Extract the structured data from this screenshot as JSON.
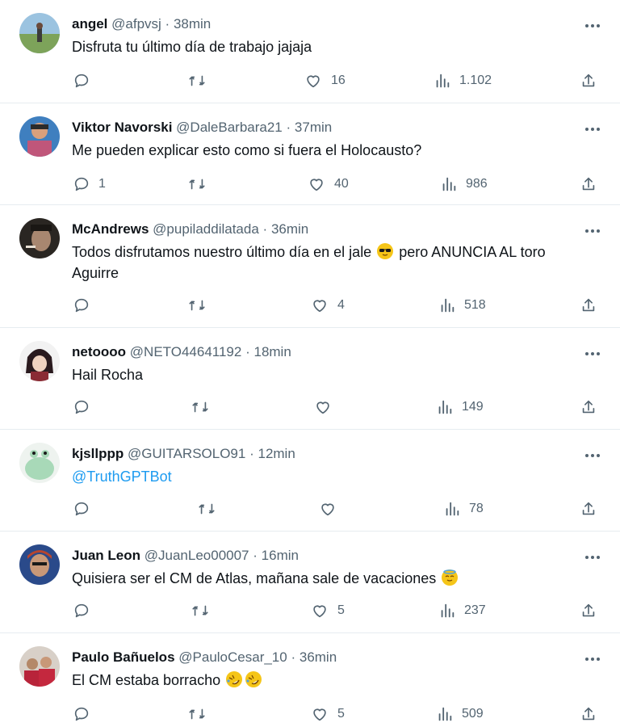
{
  "tweets": [
    {
      "name": "angel",
      "handle": "@afpvsj",
      "separator": "·",
      "time": "38min",
      "text": "Disfruta tu último día de trabajo jajaja",
      "replies": "",
      "likes": "16",
      "views": "1.102",
      "avatar_color": "#7da35a"
    },
    {
      "name": "Viktor Navorski",
      "handle": "@DaleBarbara21",
      "separator": "·",
      "time": "37min",
      "text": "Me pueden explicar esto como si fuera el Holocausto?",
      "replies": "1",
      "likes": "40",
      "views": "986",
      "avatar_color": "#c0567a"
    },
    {
      "name": "McAndrews",
      "handle": "@pupiladdilatada",
      "separator": "·",
      "time": "36min",
      "text_part1": "Todos disfrutamos nuestro último día en el jale",
      "emoji": "sunglasses-emoji",
      "text_part2": "pero ANUNCIA AL toro",
      "text_line2": "Aguirre",
      "replies": "",
      "likes": "4",
      "views": "518",
      "avatar_color": "#3a3530"
    },
    {
      "name": "netoooo",
      "handle": "@NETO44641192",
      "separator": "·",
      "time": "18min",
      "text": "Hail Rocha",
      "replies": "",
      "likes": "",
      "views": "149",
      "avatar_color": "#8a2b34"
    },
    {
      "name": "kjsllppp",
      "handle": "@GUITARSOLO91",
      "separator": "·",
      "time": "12min",
      "text": "@TruthGPTBot",
      "replies": "",
      "likes": "",
      "views": "78",
      "avatar_color": "#a8d9b8"
    },
    {
      "name": "Juan Leon",
      "handle": "@JuanLeo00007",
      "separator": "·",
      "time": "16min",
      "text": "Quisiera ser el CM de Atlas, mañana sale de vacaciones",
      "emoji": "innocent-halo-emoji",
      "replies": "",
      "likes": "5",
      "views": "237",
      "avatar_color": "#b8452e"
    },
    {
      "name": "Paulo Bañuelos",
      "handle": "@PauloCesar_10",
      "separator": "·",
      "time": "36min",
      "text": "El CM estaba borracho",
      "emoji": "rolling-laughing-emoji",
      "replies": "",
      "likes": "5",
      "views": "509",
      "avatar_color": "#b8243a"
    }
  ],
  "colors": {
    "text": "#0f1419",
    "secondary": "#536471",
    "link": "#1d9bf0",
    "divider": "#e6ecf0"
  },
  "icons": [
    "reply-icon",
    "retweet-icon",
    "like-icon",
    "views-icon",
    "share-icon",
    "more-icon"
  ]
}
